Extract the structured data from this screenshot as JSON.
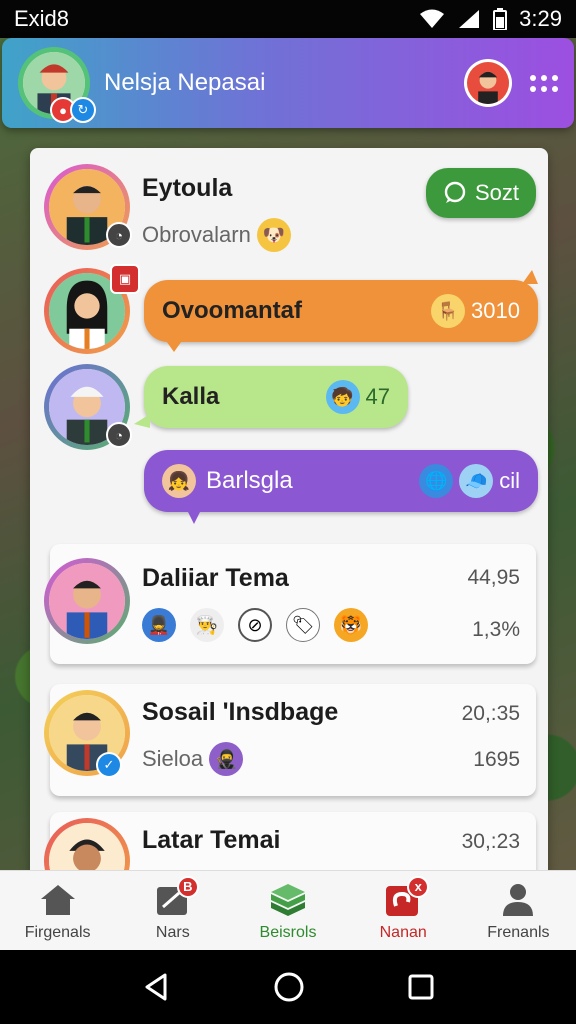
{
  "status_bar": {
    "carrier": "Exid8",
    "time": "3:29"
  },
  "header": {
    "title": "Nelsja Nepasai"
  },
  "chat": {
    "top_contact": {
      "name": "Eytoula",
      "subtitle": "Obrovalarn",
      "action_label": "Sozt"
    },
    "bubbles": [
      {
        "text": "Ovoomantaf",
        "meta": "3010",
        "color": "#f0923a"
      },
      {
        "text": "Kalla",
        "meta": "47",
        "color": "#b8e68a"
      },
      {
        "text": "Barlsgla",
        "meta": "cil",
        "color": "#8b57d2"
      }
    ],
    "cards": [
      {
        "name": "Daliiar Tema",
        "value": "44,95",
        "subvalue": "1,3%"
      },
      {
        "name": "Sosail 'Insdbage",
        "subtitle": "Sieloa",
        "value": "20,:35",
        "subvalue": "1695"
      },
      {
        "name": "Latar Temai",
        "value": "30,:23"
      }
    ]
  },
  "bottom_nav": {
    "items": [
      {
        "label": "Firgenals",
        "icon": "home-icon"
      },
      {
        "label": "Nars",
        "icon": "map-icon",
        "badge": "B"
      },
      {
        "label": "Beisrols",
        "icon": "stack-icon",
        "active": true
      },
      {
        "label": "Nanan",
        "icon": "alert-icon",
        "badge": "x"
      },
      {
        "label": "Frenanls",
        "icon": "person-icon"
      }
    ]
  },
  "colors": {
    "accent_green": "#3c9a3c",
    "header_start": "#3fa3c8",
    "header_end": "#9c4fe0",
    "alert_red": "#d32f2f"
  }
}
